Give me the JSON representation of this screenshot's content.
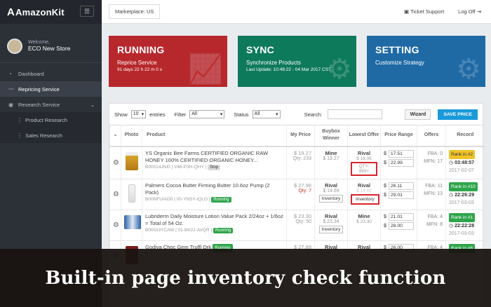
{
  "brand": {
    "logo_letter": "A",
    "logo_text": "AmazonKit"
  },
  "profile": {
    "welcome": "Welcome,",
    "store": "ECO New Store"
  },
  "nav": [
    {
      "label": "Dashboard",
      "icon": "dashboard-icon"
    },
    {
      "label": "Repricing Service",
      "icon": "chart-line-icon"
    },
    {
      "label": "Research Service",
      "icon": "eye-icon"
    },
    {
      "label": "Product Research",
      "icon": "dots-icon"
    },
    {
      "label": "Sales Research",
      "icon": "dots-icon"
    }
  ],
  "topbar": {
    "marketplace": "Marketplace: US",
    "ticket": "Ticket Support",
    "logoff": "Log Off"
  },
  "cards": [
    {
      "title": "RUNNING",
      "sub": "Reprice Service",
      "detail": "91 days 22 h 22 m 0 s"
    },
    {
      "title": "SYNC",
      "sub": "Synchronize Products",
      "detail": "Last Update: 10:48:22 - 04 Mar 2017 CST"
    },
    {
      "title": "SETTING",
      "sub": "Customize Strategy",
      "detail": ""
    }
  ],
  "filters": {
    "show": "Show",
    "show_val": "10",
    "entries": "entries",
    "filter": "Filter",
    "filter_val": "All",
    "status": "Status",
    "status_val": "All",
    "search": "Search:",
    "wizard": "Wizard",
    "save": "SAVE PRICE"
  },
  "table": {
    "headers": [
      "Photo",
      "Product",
      "My Price",
      "Buybox Winner",
      "Lowest Offer",
      "Price Range",
      "Offers",
      "Record"
    ],
    "rows": [
      {
        "name": "YS Organic Bee Farms CERTIFIED ORGANIC RAW HONEY 100% CERTIFIED ORGANIC HONEY...",
        "sku": "B00014JNI0 | V46-P3H-QHY |",
        "status": "Stop",
        "my_price": "$ 19.27",
        "qty": "Qty: 233",
        "winner": "Mine",
        "winner_price": "$ 19.27",
        "lowest": "Rival",
        "lowest_price": "$ 18.06",
        "lowest_extra": "QTY: 999+",
        "min": "17.51",
        "max": "22.99",
        "offers1": "FBA: 0",
        "offers2": "MFN: 17",
        "rank": "Rank in #2",
        "time": "03:48:57",
        "date": "2017-02-07"
      },
      {
        "name": "Palmers Cocoa Butter Firming Butter 10.6oz Pump (2 Pack)",
        "sku": "B00NFUIAD0 | 00-YNSY-IQLO |",
        "status": "Running",
        "my_price": "$ 27.96",
        "qty": "Qty: 7",
        "winner": "Rival",
        "winner_price": "$ 14.69",
        "winner_btn": "Inventory",
        "lowest": "Rival",
        "lowest_price": "$ 14.69",
        "lowest_extra": "Inventory",
        "min": "26.11",
        "max": "29.01",
        "offers1": "FBA: 11",
        "offers2": "MFN: 13",
        "rank": "Rank in #10",
        "time": "22:26:29",
        "date": "2017-03-03"
      },
      {
        "name": "Lubriderm Daily Moisture Lotion Value Pack 2/24oz + 1/6oz = Total of 54 Oz.",
        "sku": "B00GI3YCAW | 01-BK2J-AVQR |",
        "status": "Running",
        "my_price": "$ 23.30",
        "qty": "Qty: 50",
        "winner": "Rival",
        "winner_price": "$ 23.34",
        "winner_btn": "Inventory",
        "lowest": "Mine",
        "lowest_price": "$ 23.30",
        "lowest_extra": "",
        "min": "21.01",
        "max": "28.00",
        "offers1": "FBA: 4",
        "offers2": "MFN: 8",
        "rank": "Rank in #1",
        "time": "22:22:28",
        "date": "2017-03-03"
      },
      {
        "name": "Godiva Choc Gem Truffl Drk",
        "sku": "",
        "status": "Running",
        "my_price": "$ 27.88",
        "qty": "",
        "winner": "Rival",
        "winner_price": "",
        "winner_btn": "",
        "lowest": "Rival",
        "lowest_price": "",
        "lowest_extra": "",
        "min": "26.00",
        "max": "",
        "offers1": "FBA: 4",
        "offers2": "",
        "rank": "Rank in #6",
        "time": "",
        "date": ""
      }
    ]
  },
  "banner": "Built-in page inventory check function"
}
